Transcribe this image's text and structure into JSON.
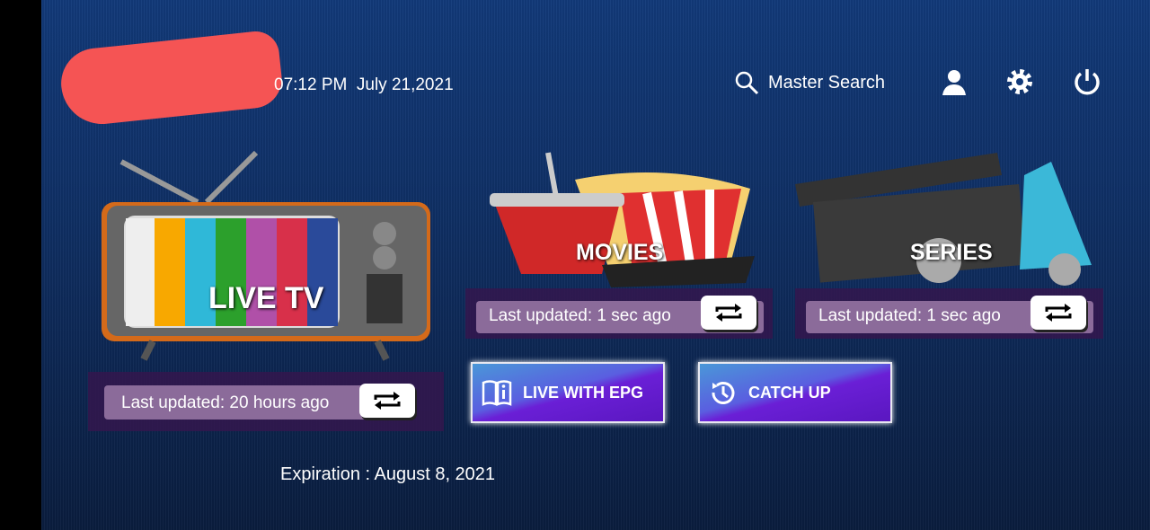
{
  "header": {
    "time": "07:12 PM",
    "date": "July 21,2021",
    "search_label": "Master Search"
  },
  "live_tv": {
    "label": "LIVE TV",
    "last_updated": "Last updated: 20 hours ago"
  },
  "movies": {
    "label": "MOVIES",
    "last_updated": "Last updated: 1 sec ago"
  },
  "series": {
    "label": "SERIES",
    "last_updated": "Last updated: 1 sec ago"
  },
  "buttons": {
    "live_epg": "LIVE WITH EPG",
    "catch_up": "CATCH UP"
  },
  "footer": {
    "expiration": "Expiration : August 8, 2021"
  },
  "colors": {
    "button_top": "#4a97d8",
    "button_bottom": "#5a17c0",
    "redaction": "#f55454"
  }
}
